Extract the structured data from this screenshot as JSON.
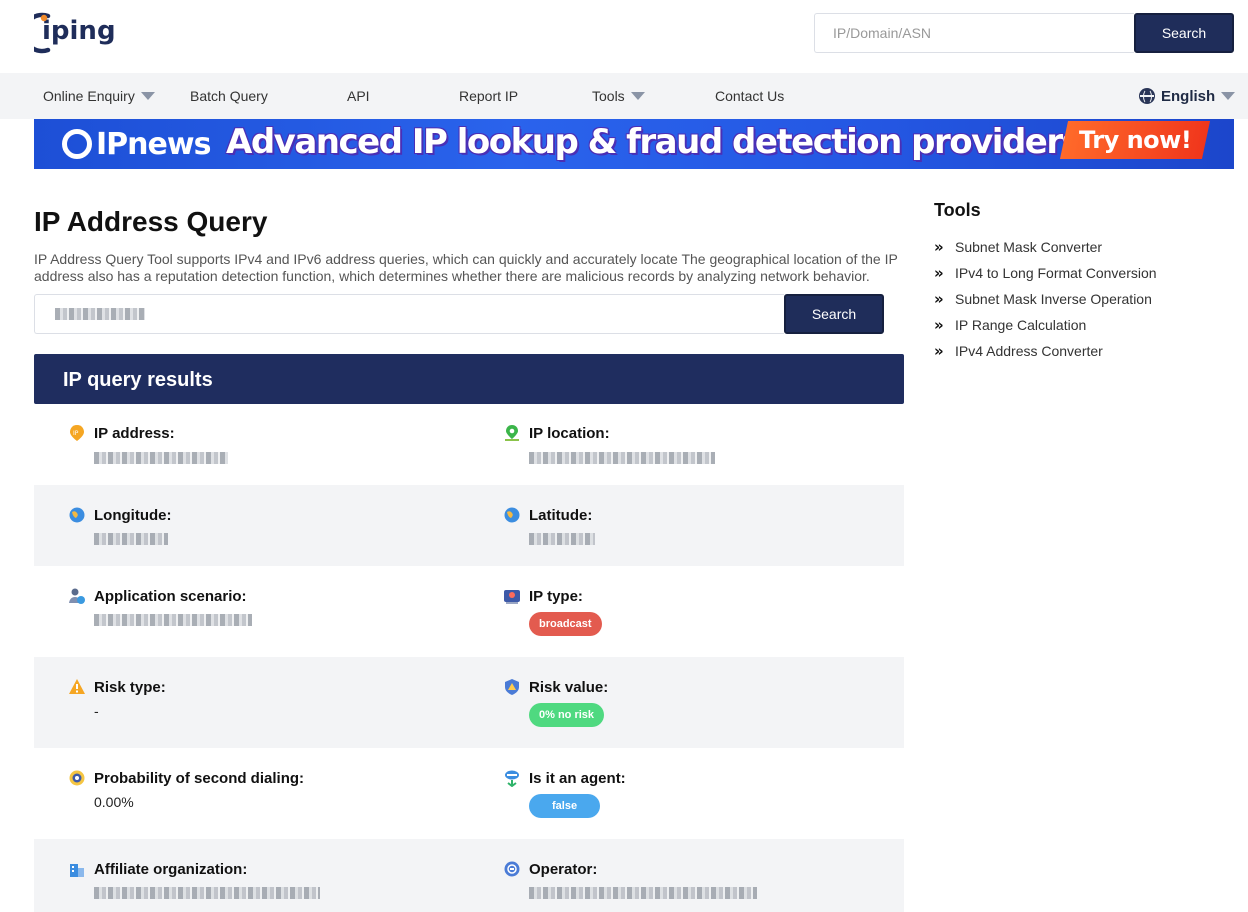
{
  "header": {
    "logo_text": "iping",
    "search_placeholder": "IP/Domain/ASN",
    "search_button": "Search"
  },
  "nav": {
    "items": [
      {
        "label": "Online Enquiry",
        "dropdown": true
      },
      {
        "label": "Batch Query",
        "dropdown": false
      },
      {
        "label": "API",
        "dropdown": false
      },
      {
        "label": "Report IP",
        "dropdown": false
      },
      {
        "label": "Tools",
        "dropdown": true
      },
      {
        "label": "Contact Us",
        "dropdown": false
      }
    ],
    "language": "English"
  },
  "banner": {
    "brand": "IPnews",
    "headline": "Advanced IP lookup & fraud detection providers",
    "cta": "Try now!"
  },
  "main": {
    "title": "IP Address Query",
    "description": "IP Address Query Tool supports IPv4 and IPv6 address queries, which can quickly and accurately locate The geographical location of the IP address also has a reputation detection function, which determines whether there are malicious records by analyzing network behavior.",
    "search_button": "Search",
    "results_title": "IP query results"
  },
  "results": {
    "ip_address": {
      "label": "IP address:",
      "value_obscured": true
    },
    "ip_location": {
      "label": "IP location:",
      "value_obscured": true
    },
    "longitude": {
      "label": "Longitude:",
      "value_obscured": true
    },
    "latitude": {
      "label": "Latitude:",
      "value_obscured": true
    },
    "application_scenario": {
      "label": "Application scenario:",
      "value_obscured": true
    },
    "ip_type": {
      "label": "IP type:",
      "value": "broadcast"
    },
    "risk_type": {
      "label": "Risk type:",
      "value": "-"
    },
    "risk_value": {
      "label": "Risk value:",
      "value": "0% no risk"
    },
    "second_dialing": {
      "label": "Probability of second dialing:",
      "value": "0.00%"
    },
    "is_agent": {
      "label": "Is it an agent:",
      "value": "false"
    },
    "affiliate_org": {
      "label": "Affiliate organization:",
      "value_obscured": true
    },
    "operator": {
      "label": "Operator:",
      "value_obscured": true
    }
  },
  "sidebar": {
    "title": "Tools",
    "items": [
      "Subnet Mask Converter",
      "IPv4 to Long Format Conversion",
      "Subnet Mask Inverse Operation",
      "IP Range Calculation",
      "IPv4 Address Converter"
    ]
  },
  "colors": {
    "primary_dark": "#1f2d5a",
    "badge_red": "#e35b4f",
    "badge_green": "#4fd980",
    "badge_blue": "#4aa8ee"
  },
  "icons": [
    "ip-pin-icon",
    "map-location-icon",
    "globe-icon",
    "scenario-icon",
    "ip-type-icon",
    "warning-icon",
    "shield-icon",
    "dial-icon",
    "agent-icon",
    "building-icon",
    "operator-icon",
    "chevron-double-right-icon",
    "caret-down-icon"
  ]
}
